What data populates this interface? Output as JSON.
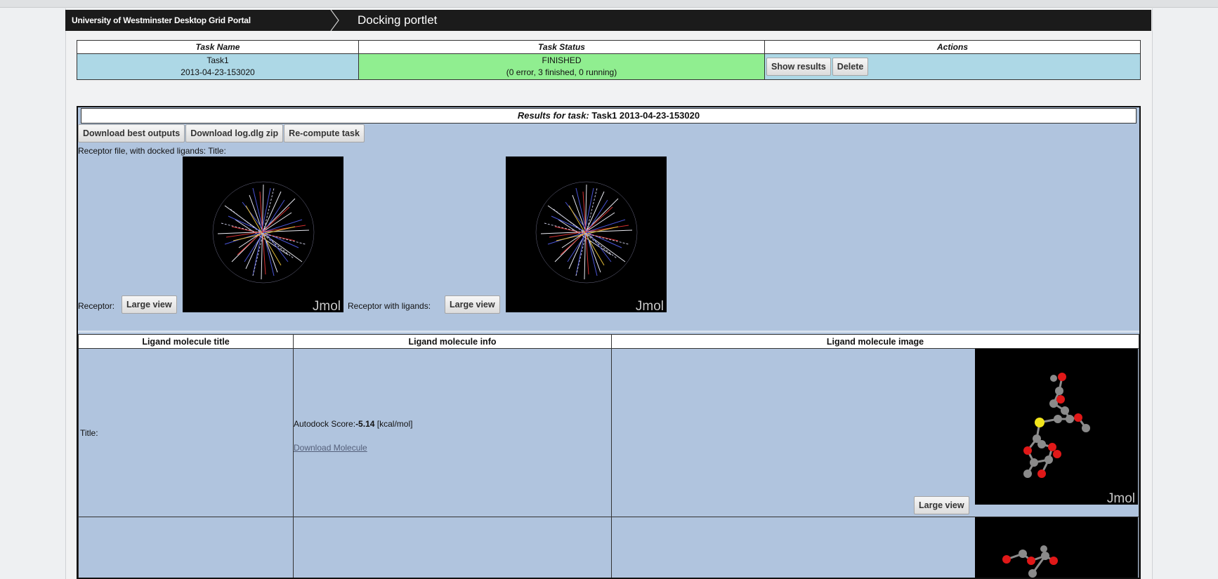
{
  "breadcrumb": {
    "portal": "University of Westminster Desktop Grid Portal",
    "portlet": "Docking portlet"
  },
  "tasks_table": {
    "headers": [
      "Task Name",
      "Task Status",
      "Actions"
    ],
    "rows": [
      {
        "name": "Task1",
        "date": "2013-04-23-153020",
        "status": "FINISHED",
        "status_detail": "(0 error, 3 finished, 0 running)",
        "actions": [
          "Show results",
          "Delete"
        ]
      }
    ]
  },
  "results": {
    "title_prefix": "Results for task:",
    "title_task": "Task1 2013-04-23-153020",
    "buttons": [
      "Download best outputs",
      "Download log.dlg zip",
      "Re-compute task"
    ],
    "receptor_label": "Receptor file, with docked ligands: Title:",
    "viewers": [
      {
        "label": "Receptor:",
        "button": "Large view",
        "watermark": "Jmol"
      },
      {
        "label": "Receptor with ligands:",
        "button": "Large view",
        "watermark": "Jmol"
      }
    ]
  },
  "ligand_table": {
    "headers": [
      "Ligand molecule title",
      "Ligand molecule info",
      "Ligand molecule image"
    ],
    "rows": [
      {
        "title": "Title:",
        "score_label": "Autodock Score:",
        "score_value": "-5.14",
        "score_unit": "[kcal/mol]",
        "download_link": "Download Molecule",
        "button": "Large view",
        "watermark": "Jmol"
      },
      {
        "title": "",
        "score_label": "",
        "score_value": "",
        "score_unit": "",
        "download_link": "",
        "button": "",
        "watermark": ""
      }
    ]
  },
  "colors": {
    "header_bar": "#1b1b1b",
    "task_row": "#add8e6",
    "status_finished": "#90ee90",
    "results_bg": "#b0c4de",
    "link": "#55607a",
    "atom_oxygen": "#e01818",
    "atom_carbon": "#8a8a8a",
    "atom_sulfur": "#f2e51c"
  }
}
